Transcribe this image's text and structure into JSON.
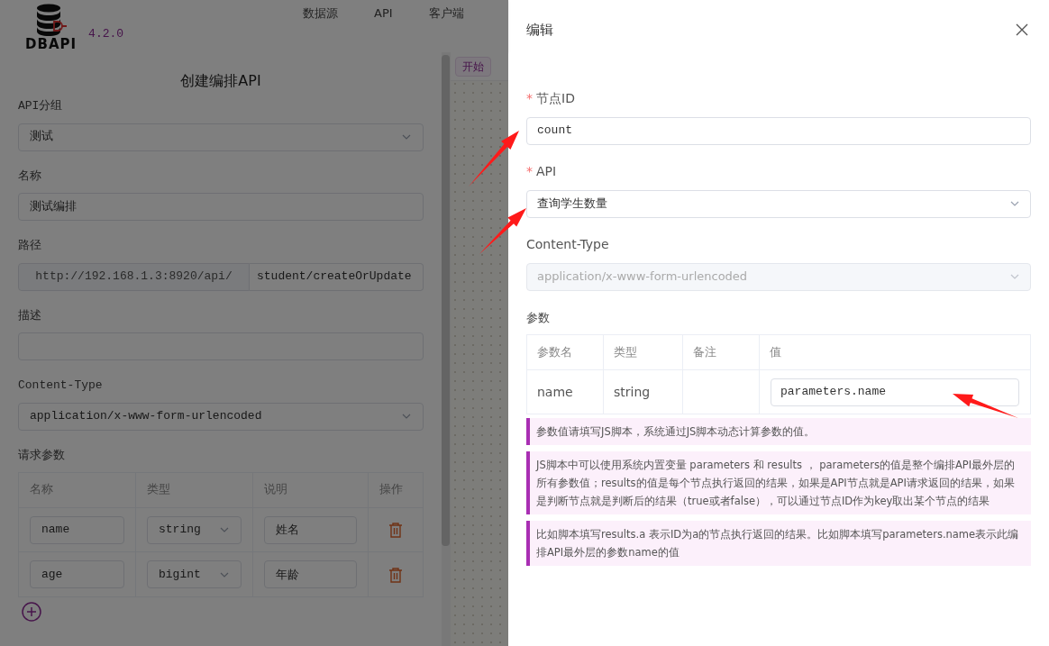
{
  "header": {
    "logo_text": "DBAPI",
    "version": "4.2.0",
    "nav": [
      "数据源",
      "API",
      "客户端"
    ]
  },
  "form": {
    "title": "创建编排API",
    "fields": [
      {
        "kind": "select",
        "label": "API分组",
        "value": "测试"
      },
      {
        "kind": "input",
        "label": "名称",
        "value": "测试编排"
      },
      {
        "kind": "path",
        "label": "路径",
        "prefix": "http://192.168.1.3:8920/api/",
        "value": "student/createOrUpdate"
      },
      {
        "kind": "input",
        "label": "描述"
      },
      {
        "kind": "select",
        "label": "Content-Type",
        "value": "application/x-www-form-urlencoded"
      }
    ],
    "params": {
      "label": "请求参数",
      "columns": [
        "名称",
        "类型",
        "说明",
        "操作"
      ],
      "rows": [
        {
          "name": "name",
          "type": "string",
          "description": "姓名"
        },
        {
          "name": "age",
          "type": "bigint",
          "description": "年龄"
        }
      ]
    }
  },
  "canvas": {
    "toolbar": [
      "开始"
    ]
  },
  "drawer": {
    "title": "编辑",
    "fields": [
      {
        "kind": "input",
        "label": "节点ID",
        "marker": "*",
        "value": "count",
        "disabled": false
      },
      {
        "kind": "select",
        "label": "API",
        "marker": "*",
        "value": "查询学生数量",
        "disabled": false
      },
      {
        "kind": "select",
        "label": "Content-Type",
        "value": "application/x-www-form-urlencoded",
        "disabled": true
      }
    ],
    "params": {
      "label": "参数",
      "columns": [
        "参数名",
        "类型",
        "备注",
        "值"
      ],
      "rows": [
        {
          "name": "name",
          "type": "string",
          "value": "parameters.name"
        }
      ]
    },
    "notes": [
      "参数值请填写JS脚本，系统通过JS脚本动态计算参数的值。",
      "JS脚本中可以使用系统内置变量 parameters 和 results ， parameters的值是整个编排API最外层的所有参数值；results的值是每个节点执行返回的结果，如果是API节点就是API请求返回的结果，如果是判断节点就是判断后的结果（true或者false），可以通过节点ID作为key取出某个节点的结果",
      "比如脚本填写results.a 表示ID为a的节点执行返回的结果。比如脚本填写parameters.name表示此编排API最外层的参数name的值"
    ]
  }
}
